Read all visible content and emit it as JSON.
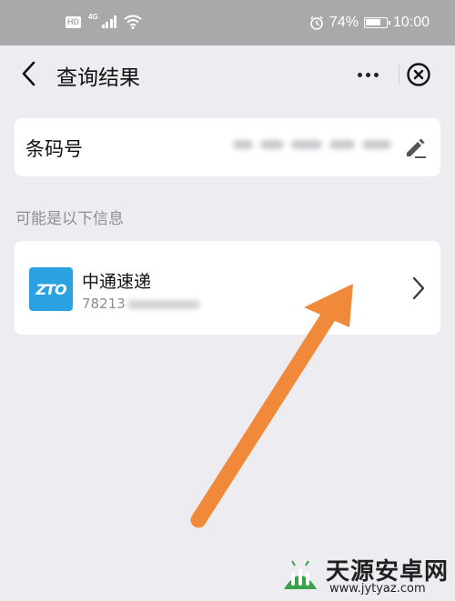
{
  "status_bar": {
    "hd": "HD",
    "network": "4G",
    "battery_pct": "74%",
    "time": "10:00"
  },
  "header": {
    "title": "查询结果"
  },
  "barcode": {
    "label": "条码号"
  },
  "section_hint": "可能是以下信息",
  "result": {
    "logo_text": "ZTO",
    "company": "中通速递",
    "tracking_prefix": "78213"
  },
  "watermark": {
    "brand": "天源安卓网",
    "url": "www.jytyaz.com"
  },
  "colors": {
    "statusbar_bg": "#a9a9ab",
    "page_bg": "#ededf1",
    "zto_blue": "#2aa2e2",
    "arrow_orange": "#f0893a",
    "logo_green": "#3aa14a"
  },
  "icons": {
    "back": "chevron-left-icon",
    "more": "more-dots-icon",
    "close": "close-circle-icon",
    "edit": "pencil-edit-icon",
    "open": "chevron-right-icon",
    "alarm": "alarm-clock-icon",
    "wifi": "wifi-icon"
  }
}
